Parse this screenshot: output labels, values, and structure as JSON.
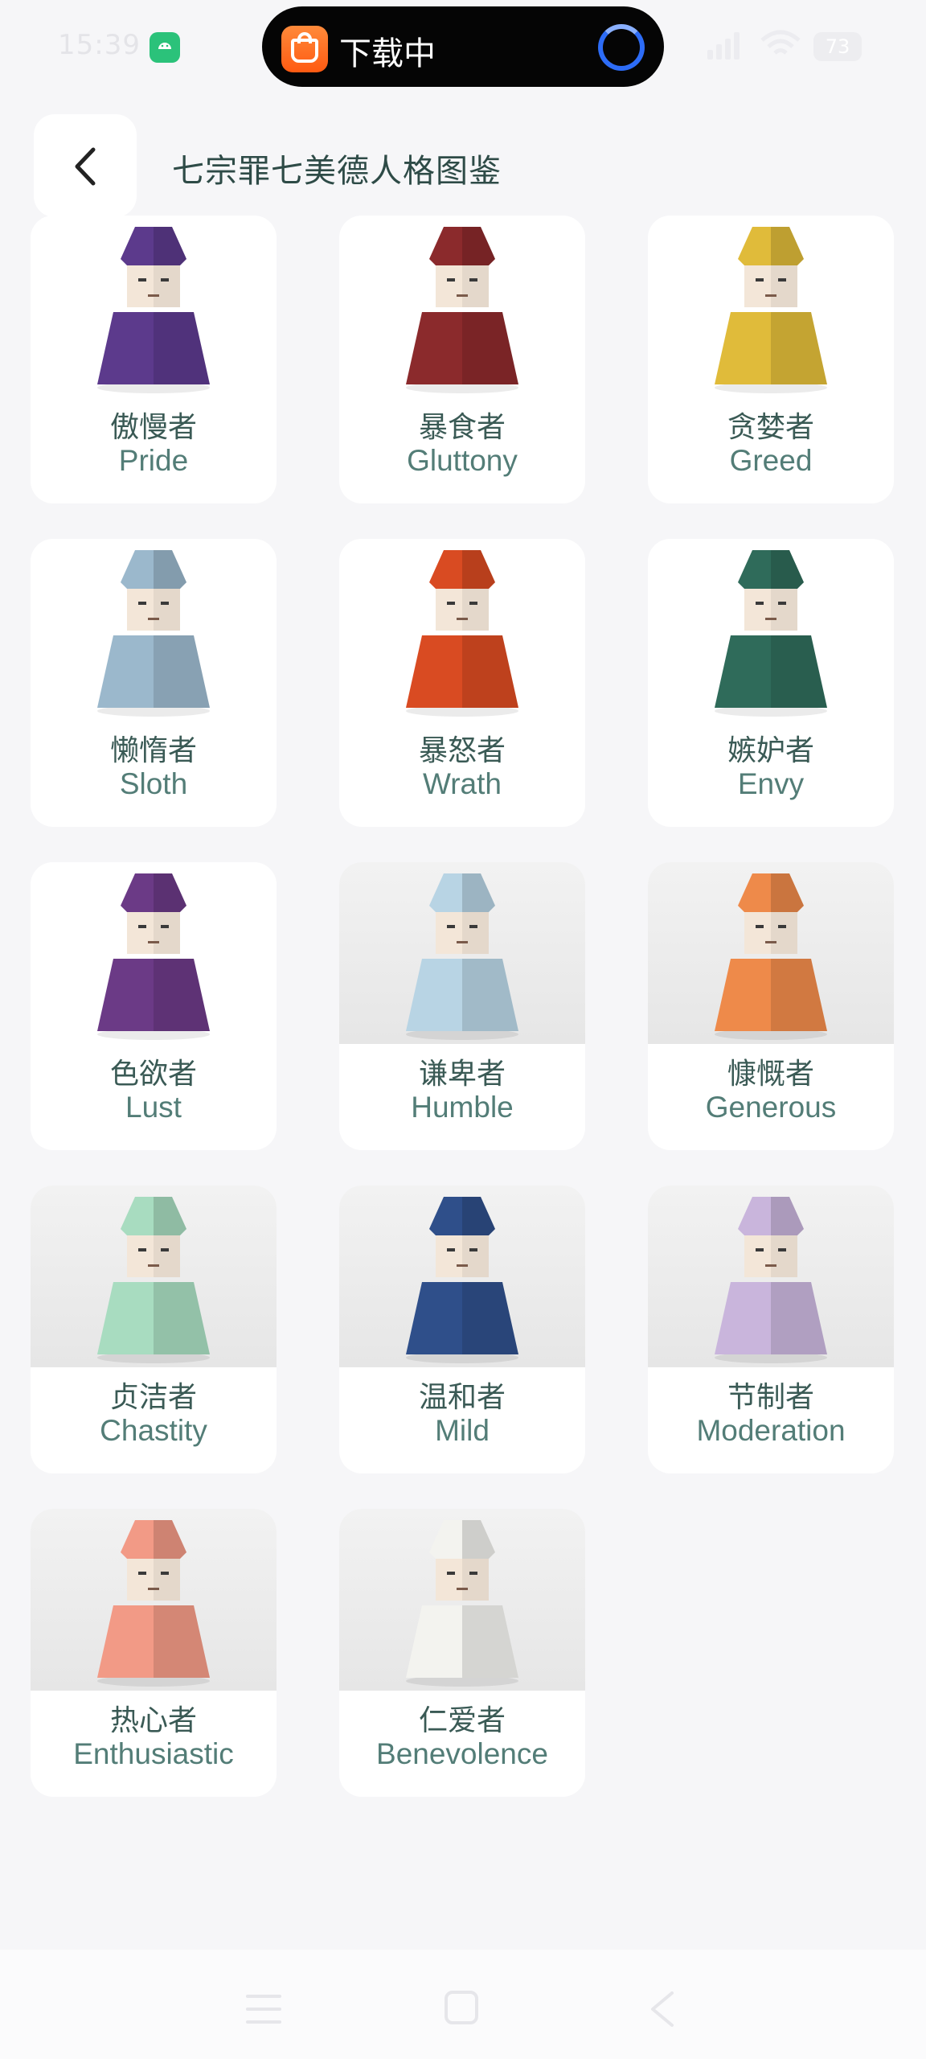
{
  "status_bar": {
    "time": "15:39",
    "download_label": "下载中",
    "battery": "73",
    "app_icon": "android-icon"
  },
  "header": {
    "title": "七宗罪七美德人格图鉴",
    "back_icon": "chevron-left-icon"
  },
  "cards": [
    {
      "zh": "傲慢者",
      "en": "Pride",
      "color": "#5c3a8c"
    },
    {
      "zh": "暴食者",
      "en": "Gluttony",
      "color": "#8b2a2c"
    },
    {
      "zh": "贪婪者",
      "en": "Greed",
      "color": "#e0bb3a"
    },
    {
      "zh": "懒惰者",
      "en": "Sloth",
      "color": "#9bb8cc"
    },
    {
      "zh": "暴怒者",
      "en": "Wrath",
      "color": "#d94b22"
    },
    {
      "zh": "嫉妒者",
      "en": "Envy",
      "color": "#2f6b5a"
    },
    {
      "zh": "色欲者",
      "en": "Lust",
      "color": "#6b3a86"
    },
    {
      "zh": "谦卑者",
      "en": "Humble",
      "color": "#b8d4e4"
    },
    {
      "zh": "慷慨者",
      "en": "Generous",
      "color": "#ee8a4a"
    },
    {
      "zh": "贞洁者",
      "en": "Chastity",
      "color": "#a8dcc0"
    },
    {
      "zh": "温和者",
      "en": "Mild",
      "color": "#2f4f8a"
    },
    {
      "zh": "节制者",
      "en": "Moderation",
      "color": "#c9b5dc"
    },
    {
      "zh": "热心者",
      "en": "Enthusiastic",
      "color": "#f29a86"
    },
    {
      "zh": "仁爱者",
      "en": "Benevolence",
      "color": "#f3f3ef"
    }
  ],
  "nav": {
    "menu_icon": "menu-icon",
    "home_icon": "home-square-icon",
    "back_icon": "back-triangle-icon"
  }
}
